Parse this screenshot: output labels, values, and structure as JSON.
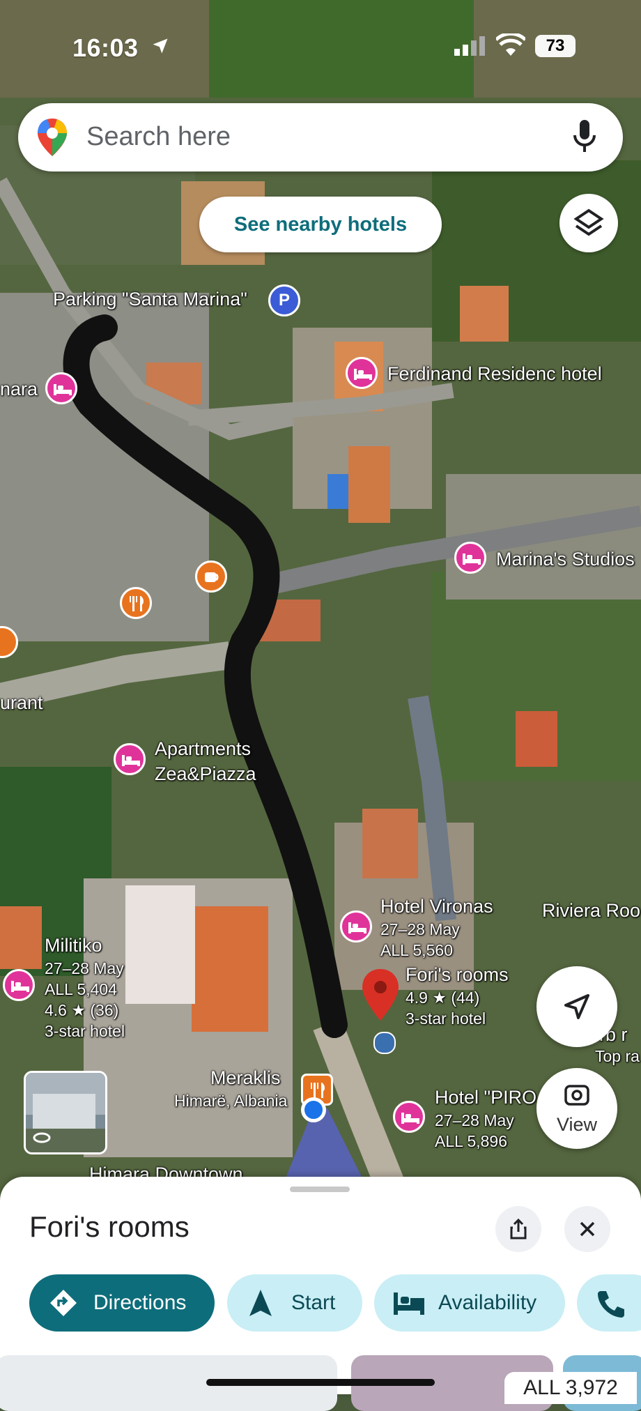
{
  "status_bar": {
    "time": "16:03",
    "battery": "73"
  },
  "search": {
    "placeholder": "Search here"
  },
  "chips": {
    "nearby_hotels": "See nearby hotels"
  },
  "map_labels": {
    "parking": "Parking \"Santa Marina\"",
    "parking_icon": "P",
    "ferdinand": "Ferdinand Residenc hotel",
    "nara": "nara",
    "marinas_studios": "Marina's Studios",
    "urant": "urant",
    "apartments_line1": "Apartments",
    "apartments_line2": "Zea&Piazza",
    "hotel_vironas": "Hotel Vironas",
    "hotel_vironas_dates": "27–28 May",
    "hotel_vironas_price": "ALL 5,560",
    "riviera": "Riviera Roo",
    "militiko": "Militiko",
    "militiko_dates": "27–28 May",
    "militiko_price": "ALL 5,404",
    "militiko_rating": "4.6 ★ (36)",
    "militiko_class": "3-star hotel",
    "fori": "Fori's rooms",
    "fori_rating": "4.9 ★ (44)",
    "fori_class": "3-star hotel",
    "herb": "rb r",
    "top_rated": "Top ra",
    "meraklis": "Meraklis",
    "himare": "Himarë, Albania",
    "hotel_piro": "Hotel \"PIRO",
    "hotel_piro_dates": "27–28 May",
    "hotel_piro_price": "ALL 5,896",
    "himara_downtown": "Himara Downtown"
  },
  "controls": {
    "view_label": "View"
  },
  "place_sheet": {
    "title": "Fori's rooms",
    "directions": "Directions",
    "start": "Start",
    "availability": "Availability",
    "price": "ALL 3,972"
  },
  "colors": {
    "accent": "#0e6d7b",
    "chip_bg": "#c9eef5",
    "hotel_pin": "#e0339a",
    "food_pin": "#e8731f",
    "selected_pin": "#d93025"
  }
}
